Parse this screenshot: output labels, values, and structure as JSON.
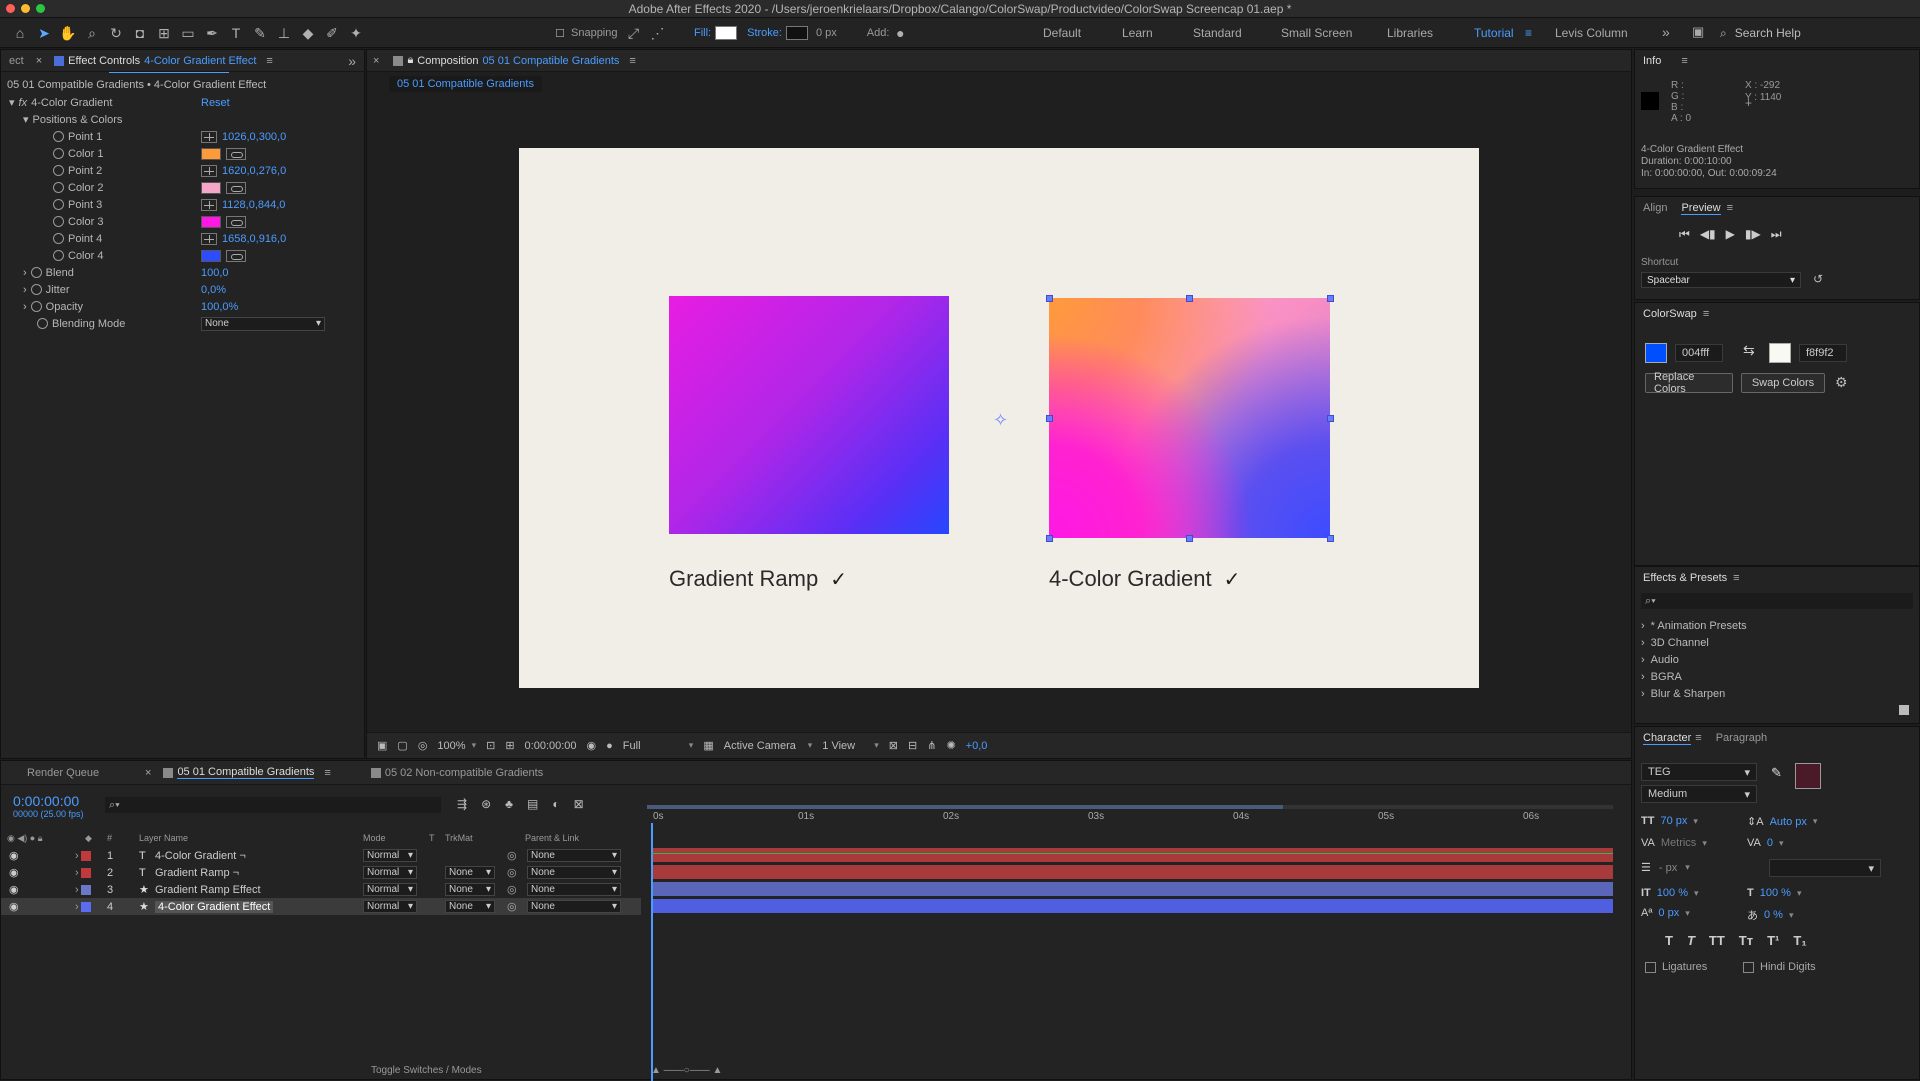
{
  "window": {
    "title": "Adobe After Effects 2020 - /Users/jeroenkrielaars/Dropbox/Calango/ColorSwap/Productvideo/ColorSwap Screencap 01.aep *"
  },
  "toolbar": {
    "snapping_label": "Snapping",
    "fill_label": "Fill:",
    "stroke_label": "Stroke:",
    "stroke_px": "0 px",
    "add_label": "Add:",
    "workspaces": [
      "Default",
      "Learn",
      "Standard",
      "Small Screen",
      "Libraries",
      "Tutorial",
      "Levis Column"
    ],
    "active_workspace": "Tutorial",
    "search_placeholder": "Search Help"
  },
  "effect_controls": {
    "tab_left": "ect",
    "tab_label": "Effect Controls",
    "tab_target": "4-Color Gradient Effect",
    "header": "05 01 Compatible Gradients • 4-Color Gradient Effect",
    "effect_name": "4-Color Gradient",
    "reset_label": "Reset",
    "group_label": "Positions & Colors",
    "props": [
      {
        "name": "Point 1",
        "value": "1026,0,300,0",
        "kind": "point"
      },
      {
        "name": "Color 1",
        "value": "",
        "kind": "color",
        "color": "#ff9a3a"
      },
      {
        "name": "Point 2",
        "value": "1620,0,276,0",
        "kind": "point"
      },
      {
        "name": "Color 2",
        "value": "",
        "kind": "color",
        "color": "#f7a6c8"
      },
      {
        "name": "Point 3",
        "value": "1128,0,844,0",
        "kind": "point"
      },
      {
        "name": "Color 3",
        "value": "",
        "kind": "color",
        "color": "#ff17e6"
      },
      {
        "name": "Point 4",
        "value": "1658,0,916,0",
        "kind": "point"
      },
      {
        "name": "Color 4",
        "value": "",
        "kind": "color",
        "color": "#2d4cff"
      }
    ],
    "blend_label": "Blend",
    "blend_value": "100,0",
    "jitter_label": "Jitter",
    "jitter_value": "0,0%",
    "opacity_label": "Opacity",
    "opacity_value": "100,0%",
    "blending_mode_label": "Blending Mode",
    "blending_mode_value": "None"
  },
  "composition": {
    "tab_label": "Composition",
    "tab_target": "05 01 Compatible Gradients",
    "subtab": "05 01 Compatible Gradients",
    "card1_label": "Gradient Ramp",
    "card2_label": "4-Color Gradient",
    "check": "✓",
    "zoom": "100%",
    "timecode": "0:00:00:00",
    "resolution": "Full",
    "camera": "Active Camera",
    "views": "1 View",
    "exposure": "+0,0"
  },
  "info": {
    "title": "Info",
    "r": "R :",
    "g": "G :",
    "b": "B :",
    "a": "A : 0",
    "x": "X : -292",
    "y": "Y : 1140",
    "effect": "4-Color Gradient Effect",
    "duration": "Duration: 0:00:10:00",
    "in_out": "In: 0:00:00:00, Out: 0:00:09:24"
  },
  "preview": {
    "align_tab": "Align",
    "preview_tab": "Preview",
    "shortcut_label": "Shortcut",
    "shortcut_value": "Spacebar"
  },
  "colorswap": {
    "title": "ColorSwap",
    "color_a_hex": "004fff",
    "color_a": "#004fff",
    "color_b_hex": "f8f9f2",
    "color_b": "#f8f9f2",
    "replace_label": "Replace Colors",
    "swap_label": "Swap Colors"
  },
  "effects_presets": {
    "title": "Effects & Presets",
    "items": [
      "* Animation Presets",
      "3D Channel",
      "Audio",
      "BGRA",
      "Blur & Sharpen"
    ]
  },
  "character": {
    "tab": "Character",
    "tab2": "Paragraph",
    "font": "TEG",
    "style": "Medium",
    "size": "70 px",
    "leading": "Auto px",
    "kerning": "Metrics",
    "tracking": "0",
    "stroke_width": "- px",
    "vscale": "100 %",
    "hscale": "100 %",
    "baseline": "0 px",
    "tsume": "0 %",
    "ligatures": "Ligatures",
    "hindi": "Hindi Digits"
  },
  "timeline": {
    "render_queue": "Render Queue",
    "tab1": "05 01 Compatible Gradients",
    "tab2": "05 02 Non-compatible Gradients",
    "timecode": "0:00:00:00",
    "fps": "00000 (25.00 fps)",
    "col_layer": "Layer Name",
    "col_mode": "Mode",
    "col_t": "T",
    "col_trkmat": "TrkMat",
    "col_parent": "Parent & Link",
    "ruler": [
      "0s",
      "01s",
      "02s",
      "03s",
      "04s",
      "05s",
      "06s"
    ],
    "layers": [
      {
        "num": "1",
        "type": "T",
        "name": "4-Color Gradient ¬",
        "mode": "Normal",
        "trkmat": "",
        "parent": "None",
        "label": "#c0393b",
        "bar": "#a83a3c",
        "sel": false
      },
      {
        "num": "2",
        "type": "T",
        "name": "Gradient Ramp ¬",
        "mode": "Normal",
        "trkmat": "None",
        "parent": "None",
        "label": "#c0393b",
        "bar": "#a83a3c",
        "sel": false
      },
      {
        "num": "3",
        "type": "★",
        "name": "Gradient Ramp Effect",
        "mode": "Normal",
        "trkmat": "None",
        "parent": "None",
        "label": "#6a78c8",
        "bar": "#5a66b8",
        "sel": false
      },
      {
        "num": "4",
        "type": "★",
        "name": "4-Color Gradient Effect",
        "mode": "Normal",
        "trkmat": "None",
        "parent": "None",
        "label": "#5a6df0",
        "bar": "#4f5fe0",
        "sel": true
      }
    ],
    "toggle_label": "Toggle Switches / Modes"
  }
}
